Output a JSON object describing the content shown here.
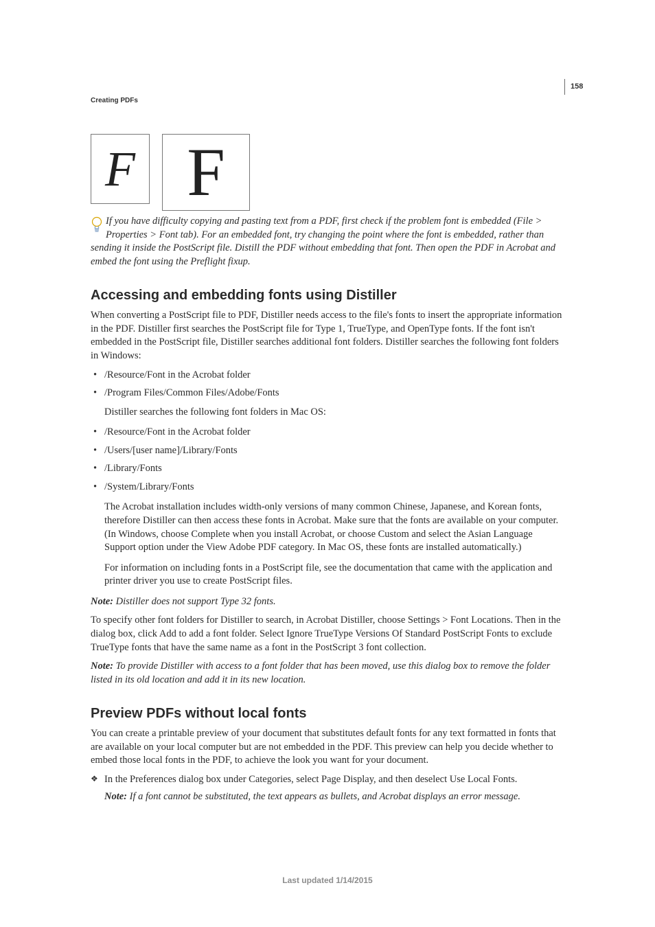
{
  "header": {
    "section": "Creating PDFs",
    "page_number": "158"
  },
  "glyphs": {
    "left": "F",
    "right": "F"
  },
  "tip": {
    "text": "If you have difficulty copying and pasting text from a PDF, first check if the problem font is embedded (File > Properties > Font tab). For an embedded font, try changing the point where the font is embedded, rather than sending it inside the PostScript file. Distill the PDF without embedding that font. Then open the PDF in Acrobat and embed the font using the Preflight fixup."
  },
  "section1": {
    "heading": "Accessing and embedding fonts using Distiller",
    "intro": "When converting a PostScript file to PDF, Distiller needs access to the file's fonts to insert the appropriate information in the PDF. Distiller first searches the PostScript file for Type 1, TrueType, and OpenType fonts. If the font isn't embedded in the PostScript file, Distiller searches additional font folders. Distiller searches the following font folders in Windows:",
    "win_list": [
      "/Resource/Font in the Acrobat folder",
      "/Program Files/Common Files/Adobe/Fonts"
    ],
    "mac_intro": "Distiller searches the following font folders in Mac OS:",
    "mac_list": [
      "/Resource/Font in the Acrobat folder",
      "/Users/[user name]/Library/Fonts",
      "/Library/Fonts",
      "/System/Library/Fonts"
    ],
    "para_cjk": "The Acrobat installation includes width-only versions of many common Chinese, Japanese, and Korean fonts, therefore Distiller can then access these fonts in Acrobat. Make sure that the fonts are available on your computer. (In Windows, choose Complete when you install Acrobat, or choose Custom and select the Asian Language Support option under the View Adobe PDF category. In Mac OS, these fonts are installed automatically.)",
    "para_info": "For information on including fonts in a PostScript file, see the documentation that came with the application and printer driver you use to create PostScript files.",
    "note1_label": "Note:",
    "note1_body": " Distiller does not support Type 32 fonts.",
    "para_specify": "To specify other font folders for Distiller to search, in Acrobat Distiller, choose Settings > Font Locations. Then in the dialog box, click Add to add a font folder. Select Ignore TrueType Versions Of Standard PostScript Fonts to exclude TrueType fonts that have the same name as a font in the PostScript 3 font collection.",
    "note2_label": "Note:",
    "note2_body": " To provide Distiller with access to a font folder that has been moved, use this dialog box to remove the folder listed in its old location and add it in its new location."
  },
  "section2": {
    "heading": "Preview PDFs without local fonts",
    "intro": "You can create a printable preview of your document that substitutes default fonts for any text formatted in fonts that are available on your local computer but are not embedded in the PDF. This preview can help you decide whether to embed those local fonts in the PDF, to achieve the look you want for your document.",
    "step": "In the Preferences dialog box under Categories, select Page Display, and then deselect Use Local Fonts.",
    "note_label": "Note:",
    "note_body": " If a font cannot be substituted, the text appears as bullets, and Acrobat displays an error message."
  },
  "footer": {
    "text": "Last updated 1/14/2015"
  }
}
